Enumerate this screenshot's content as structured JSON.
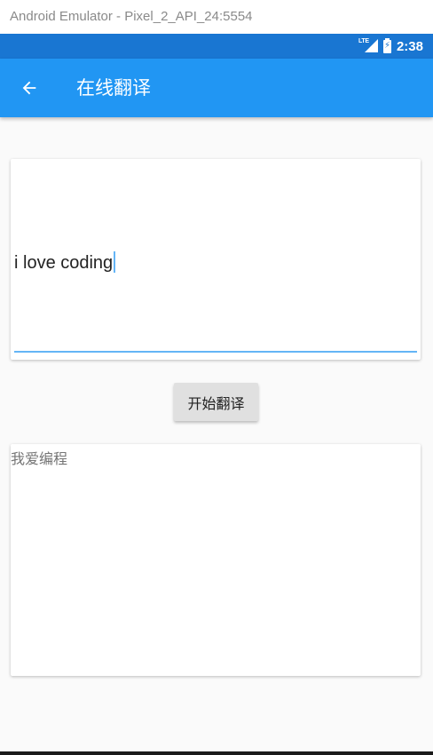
{
  "window": {
    "title": "Android Emulator - Pixel_2_API_24:5554"
  },
  "status_bar": {
    "network": "LTE",
    "signal_icon": "cellular-signal-icon",
    "battery_icon": "battery-charging-icon",
    "time": "2:38"
  },
  "app_bar": {
    "back_icon": "arrow-back-icon",
    "title": "在线翻译"
  },
  "input": {
    "value": "i love coding"
  },
  "translate_button": {
    "label": "开始翻译"
  },
  "output": {
    "text": "我爱编程"
  },
  "colors": {
    "status_bar": "#1976d2",
    "app_bar": "#2196f3",
    "accent_underline": "#64b5f6",
    "background": "#fafafa",
    "button": "#e0e0e0"
  }
}
